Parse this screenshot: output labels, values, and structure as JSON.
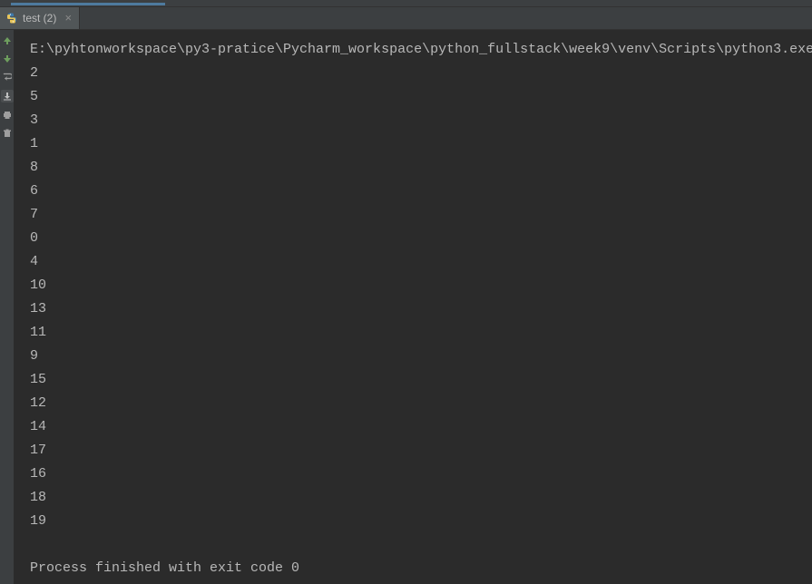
{
  "tab": {
    "label": "test (2)",
    "icon": "python-icon"
  },
  "console": {
    "command": "E:\\pyhtonworkspace\\py3-pratice\\Pycharm_workspace\\python_fullstack\\week9\\venv\\Scripts\\python3.exe",
    "output": [
      "2",
      "5",
      "3",
      "1",
      "8",
      "6",
      "7",
      "0",
      "4",
      "10",
      "13",
      "11",
      "9",
      "15",
      "12",
      "14",
      "17",
      "16",
      "18",
      "19"
    ],
    "exit_message": "Process finished with exit code 0"
  },
  "gutter": {
    "icons": [
      "arrow-up",
      "arrow-down",
      "wrap",
      "download",
      "print",
      "trash"
    ]
  }
}
